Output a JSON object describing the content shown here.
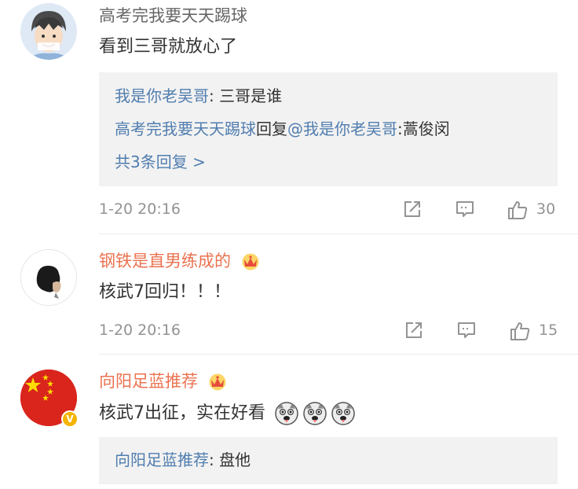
{
  "comments": [
    {
      "username": "高考完我要天天踢球",
      "text": "看到三哥就放心了",
      "replies": [
        {
          "user": "我是你老吴哥",
          "sep": ": ",
          "text": "三哥是谁"
        },
        {
          "user": "高考完我要天天踢球",
          "mid": "回复",
          "mention": "@我是你老吴哥",
          "sep": ":",
          "text": "蒿俊闵"
        }
      ],
      "more_replies": "共3条回复 >",
      "time": "1-20 20:16",
      "likes": "30"
    },
    {
      "username": "钢铁是直男练成的",
      "text": "核武7回归！！！",
      "time": "1-20 20:16",
      "likes": "15"
    },
    {
      "username": "向阳足蓝推荐",
      "text": "核武7出征，实在好看",
      "replies": [
        {
          "user": "向阳足蓝推荐",
          "sep": ": ",
          "text": "盘他"
        }
      ]
    }
  ],
  "icons": {
    "share": "share-icon",
    "comment": "comment-icon",
    "like": "thumbs-up-icon",
    "crown": "vip-crown-icon",
    "verified": "verified-v-icon",
    "emoji": "dog-face-emoji"
  },
  "colors": {
    "link": "#507daf",
    "vip_name": "#eb7350",
    "meta": "#939393",
    "reply_bg": "#f2f2f2"
  }
}
